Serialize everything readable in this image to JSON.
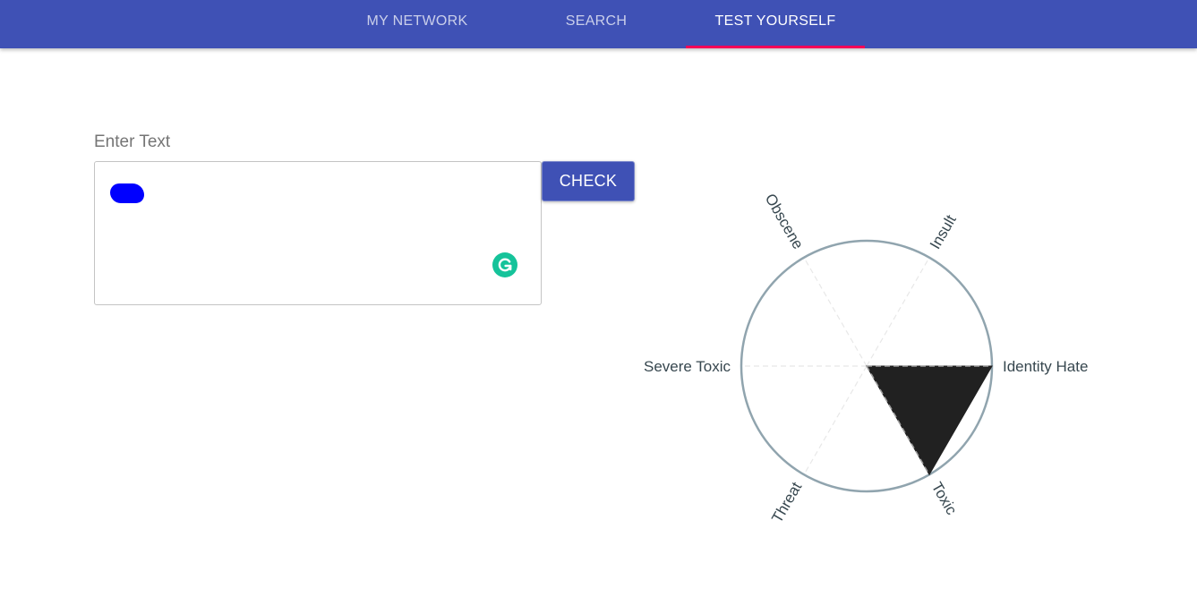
{
  "nav": {
    "tabs": [
      {
        "label": "MY NETWORK"
      },
      {
        "label": "SEARCH"
      },
      {
        "label": "TEST YOURSELF"
      }
    ],
    "active_tab": "TEST YOURSELF"
  },
  "form": {
    "label": "Enter Text",
    "check_label": "CHECK",
    "text_value": ""
  },
  "colors": {
    "appbar": "#3f51b5",
    "tab_indicator": "#f50057",
    "radar_fill": "#212121",
    "radar_outline": "#90a4ae",
    "redaction": "#0000ff",
    "grammarly": "#15c39a"
  },
  "icons": {
    "grammarly": "grammarly-icon"
  },
  "chart_data": {
    "type": "radar",
    "categories": [
      "Identity Hate",
      "Insult",
      "Obscene",
      "Severe Toxic",
      "Threat",
      "Toxic"
    ],
    "series": [
      {
        "values": [
          1,
          0,
          0,
          0,
          0,
          1
        ]
      }
    ],
    "rlim": [
      0,
      1
    ],
    "grid": true
  }
}
